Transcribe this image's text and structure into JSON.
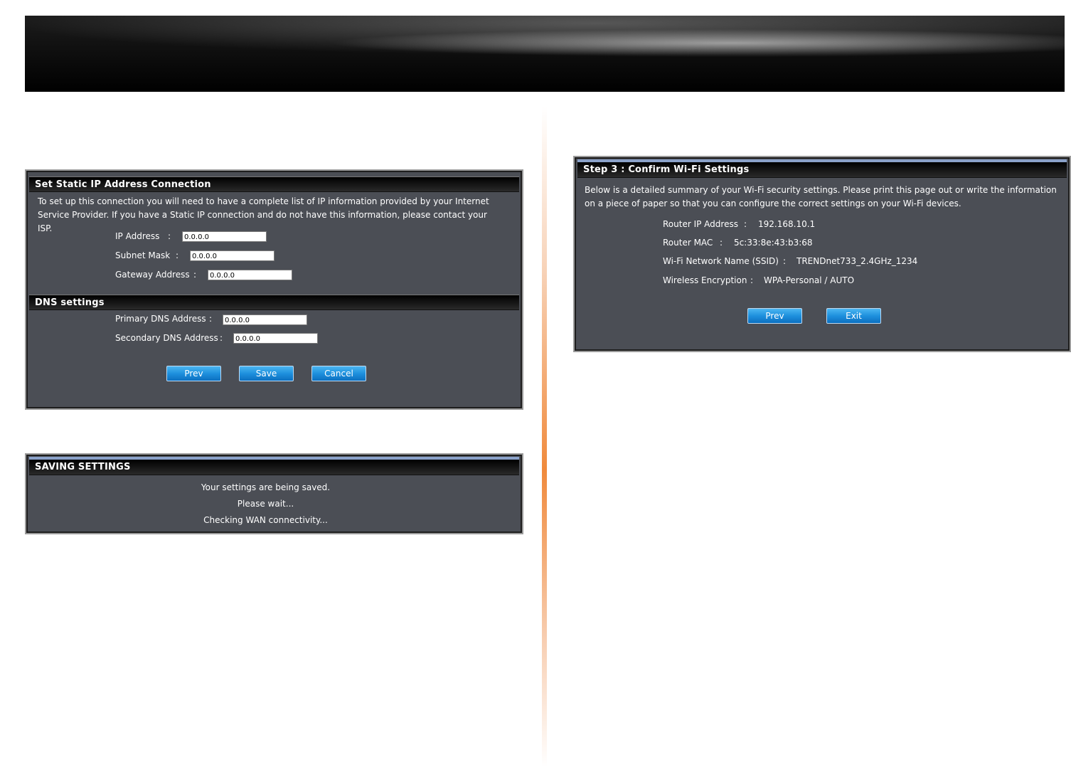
{
  "static_ip": {
    "title": "Set Static IP Address Connection",
    "description": "To set up this connection you will need to have a complete list of IP information provided by your Internet Service Provider. If you have a Static IP connection and do not have this information, please contact your ISP.",
    "fields": [
      {
        "label": "IP Address",
        "colon": ":",
        "value": "0.0.0.0"
      },
      {
        "label": "Subnet Mask",
        "colon": ":",
        "value": "0.0.0.0"
      },
      {
        "label": "Gateway Address",
        "colon": ":",
        "value": "0.0.0.0"
      }
    ],
    "dns_title": "DNS settings",
    "dns_fields": [
      {
        "label": "Primary DNS Address",
        "colon": ":",
        "value": "0.0.0.0"
      },
      {
        "label": "Secondary DNS Address",
        "colon": ":",
        "value": "0.0.0.0"
      }
    ],
    "buttons": {
      "prev": "Prev",
      "save": "Save",
      "cancel": "Cancel"
    }
  },
  "saving": {
    "title": "SAVING SETTINGS",
    "lines": [
      "Your settings are being saved.",
      "Please wait...",
      "Checking WAN connectivity..."
    ]
  },
  "confirm": {
    "title": "Step 3 : Confirm Wi-Fi Settings",
    "description": "Below is a detailed summary of your Wi-Fi security settings. Please print this page out or write the information on a piece of paper so that you can configure the correct settings on your Wi-Fi devices.",
    "rows": [
      {
        "label": "Router IP Address",
        "colon": ":",
        "value": "192.168.10.1"
      },
      {
        "label": "Router MAC",
        "colon": ":",
        "value": "5c:33:8e:43:b3:68"
      },
      {
        "label": "Wi-Fi Network Name (SSID)",
        "colon": ":",
        "value": "TRENDnet733_2.4GHz_1234"
      },
      {
        "label": "Wireless Encryption",
        "colon": ":",
        "value": "WPA-Personal / AUTO"
      }
    ],
    "buttons": {
      "prev": "Prev",
      "exit": "Exit"
    }
  },
  "colors": {
    "button_blue": "#1e90dd",
    "divider_orange": "#f08a3c",
    "panel_bg": "#4b4e55"
  }
}
